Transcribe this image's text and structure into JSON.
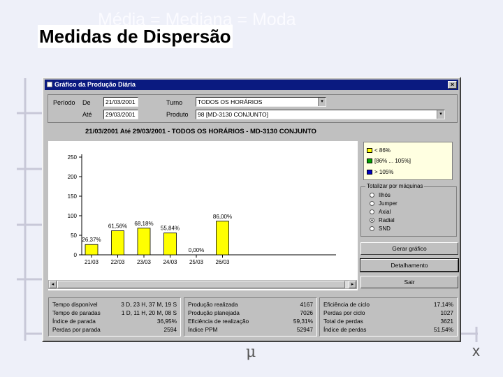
{
  "slide": {
    "ghost_title": "Média = Mediana = Moda",
    "title": "Medidas de Dispersão",
    "mu_symbol": "μ",
    "xbar_symbol": "x"
  },
  "window": {
    "title": "Gráfico da Produção Diária",
    "close_glyph": "×"
  },
  "filters": {
    "periodo_label": "Período",
    "de_label": "De",
    "de_value": "21/03/2001",
    "ate_label": "Até",
    "ate_value": "29/03/2001",
    "turno_label": "Turno",
    "turno_value": "TODOS OS HORÁRIOS",
    "produto_label": "Produto",
    "produto_value": "98 [MD-3130 CONJUNTO]",
    "dropdown_glyph": "▾"
  },
  "chart_header": "21/03/2001 Até 29/03/2001 - TODOS OS HORÁRIOS - MD-3130 CONJUNTO",
  "chart_data": {
    "type": "bar",
    "categories": [
      "21/03",
      "22/03",
      "23/03",
      "24/03",
      "25/03",
      "26/03"
    ],
    "values": [
      26.37,
      61.56,
      68.18,
      55.84,
      0.0,
      86.0
    ],
    "data_labels": [
      "26,37%",
      "61,56%",
      "68,18%",
      "55,84%",
      "0,00%",
      "86,00%"
    ],
    "yticks": [
      "0",
      "50",
      "100",
      "150",
      "200",
      "250"
    ],
    "ylim": [
      0,
      250
    ],
    "bar_color": "#ffff00",
    "grid": false
  },
  "legend": {
    "items": [
      {
        "label": "< 86%",
        "color": "#ffff00"
      },
      {
        "label": "[86% ... 105%]",
        "color": "#00a000"
      },
      {
        "label": "> 105%",
        "color": "#0000c0"
      }
    ]
  },
  "totalizar": {
    "caption": "Totalizar por máquinas",
    "options": [
      "Ilhós",
      "Jumper",
      "Axial",
      "Radial",
      "SND"
    ],
    "selected": "Radial"
  },
  "buttons": {
    "gerar": "Gerar gráfico",
    "detalhamento": "Detalhamento",
    "sair": "Sair"
  },
  "scroll": {
    "left": "◂",
    "right": "▸"
  },
  "stats": {
    "col1": [
      {
        "label": "Tempo disponível",
        "value": "3 D, 23 H, 37 M, 19 S"
      },
      {
        "label": "Tempo de paradas",
        "value": "1 D, 11 H, 20 M, 08 S"
      },
      {
        "label": "Índice de parada",
        "value": "36,95%"
      },
      {
        "label": "Perdas por parada",
        "value": "2594"
      }
    ],
    "col2": [
      {
        "label": "Produção realizada",
        "value": "4167"
      },
      {
        "label": "Produção planejada",
        "value": "7026"
      },
      {
        "label": "Eficiência de realização",
        "value": "59,31%"
      },
      {
        "label": "Índice PPM",
        "value": "52947"
      }
    ],
    "col3": [
      {
        "label": "Eficiência de ciclo",
        "value": "17,14%"
      },
      {
        "label": "Perdas por ciclo",
        "value": "1027"
      },
      {
        "label": "Total de perdas",
        "value": "3621"
      },
      {
        "label": "Índice de perdas",
        "value": "51,54%"
      }
    ]
  }
}
